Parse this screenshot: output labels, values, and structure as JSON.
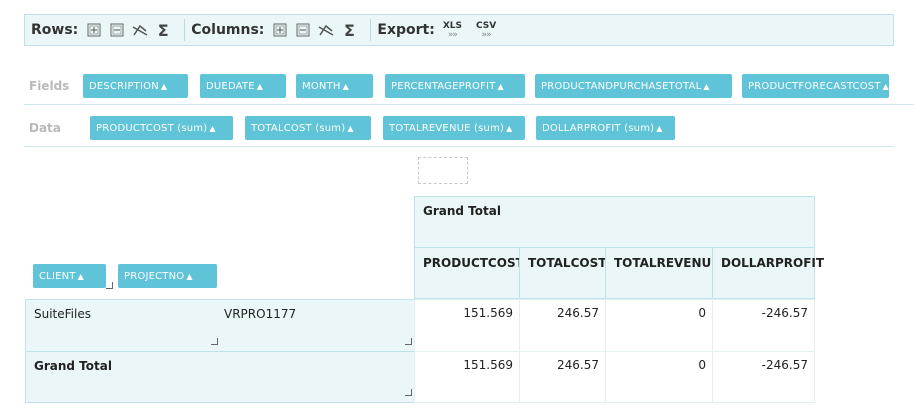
{
  "toolbar": {
    "rows_label": "Rows:",
    "columns_label": "Columns:",
    "export_label": "Export:",
    "xls_label": "XLS",
    "csv_label": "CSV",
    "arrows": "»»",
    "sigma": "Σ"
  },
  "fields": {
    "label": "Fields",
    "items": [
      "DESCRIPTION",
      "DUEDATE",
      "MONTH",
      "PERCENTAGEPROFIT",
      "PRODUCTANDPURCHASETOTAL",
      "PRODUCTFORECASTCOST"
    ]
  },
  "data_row": {
    "label": "Data",
    "items": [
      "PRODUCTCOST (sum)",
      "TOTALCOST (sum)",
      "TOTALREVENUE (sum)",
      "DOLLARPROFIT (sum)"
    ]
  },
  "row_fields": [
    "CLIENT",
    "PROJECTNO"
  ],
  "grid": {
    "grand_total_header": "Grand Total",
    "columns": [
      "PRODUCTCOST",
      "TOTALCOST",
      "TOTALREVENUE",
      "DOLLARPROFIT"
    ],
    "rows": [
      {
        "client": "SuiteFiles",
        "project": "VRPRO1177",
        "values": [
          "151.569",
          "246.57",
          "0",
          "-246.57"
        ]
      }
    ],
    "grand_total_row": {
      "label": "Grand Total",
      "values": [
        "151.569",
        "246.57",
        "0",
        "-246.57"
      ]
    }
  }
}
